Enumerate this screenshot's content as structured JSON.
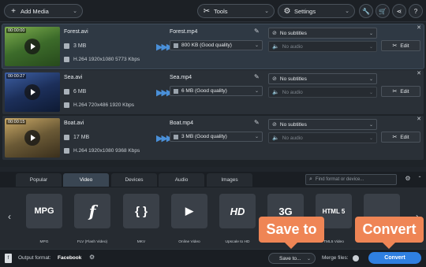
{
  "toolbar": {
    "add_media": "Add Media",
    "tools": "Tools",
    "settings": "Settings"
  },
  "files": [
    {
      "duration": "00:00:00",
      "name": "Forest.avi",
      "size": "3 MB",
      "info": "H.264 1920x1080 5773 Kbps",
      "output_name": "Forest.mp4",
      "quality": "800 KB (Good quality)",
      "subtitles": "No subtitles",
      "audio": "No audio",
      "edit": "Edit",
      "selected": true,
      "thumb_colors": [
        "#3c6b2a",
        "#7fae4e",
        "#274a1c"
      ]
    },
    {
      "duration": "00:00:27",
      "name": "Sea.avi",
      "size": "6 MB",
      "info": "H.264 720x486 1920 Kbps",
      "output_name": "Sea.mp4",
      "quality": "6 MB (Good quality)",
      "subtitles": "No subtitles",
      "audio": "No audio",
      "edit": "Edit",
      "selected": false,
      "thumb_colors": [
        "#1c2f5a",
        "#3d5fa3",
        "#0e1a33"
      ]
    },
    {
      "duration": "00:00:15",
      "name": "Boat.avi",
      "size": "17 MB",
      "info": "H.264 1920x1080 9368 Kbps",
      "output_name": "Boat.mp4",
      "quality": "3 MB (Good quality)",
      "subtitles": "No subtitles",
      "audio": "No audio",
      "edit": "Edit",
      "selected": false,
      "thumb_colors": [
        "#6b5a36",
        "#c9a866",
        "#3a2f1c"
      ]
    }
  ],
  "tabs": [
    "Popular",
    "Video",
    "Devices",
    "Audio",
    "Images"
  ],
  "active_tab": "Video",
  "search": {
    "placeholder": "Find format or device..."
  },
  "formats": [
    {
      "tile": "MPG",
      "label": "MPG"
    },
    {
      "tile": "f",
      "label": "FLV (Flash Video)"
    },
    {
      "tile": "{ }",
      "label": "MKV"
    },
    {
      "tile": "▶",
      "label": "Online Video"
    },
    {
      "tile": "HD",
      "label": "Upscale to HD"
    },
    {
      "tile": "3G",
      "label": ""
    },
    {
      "tile": "HTML 5",
      "label": "TML5 Video"
    },
    {
      "tile": "",
      "label": ""
    }
  ],
  "bottom": {
    "output_label": "Output format:",
    "output_value": "Facebook",
    "save_to": "Save to...",
    "merge_label": "Merge files:",
    "convert": "Convert"
  },
  "callouts": {
    "save_to": "Save to",
    "convert": "Convert"
  },
  "colors": {
    "accent": "#2f7fe0",
    "callout": "#ef8555"
  }
}
